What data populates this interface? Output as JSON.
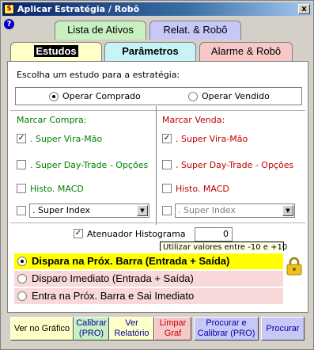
{
  "window": {
    "title": "Aplicar Estratégia / Robô",
    "close_label": "x",
    "help_label": "?"
  },
  "tabs_top": [
    {
      "label": "Lista de Ativos"
    },
    {
      "label": "Relat. & Robô"
    }
  ],
  "tabs_bottom": [
    {
      "label": "Estudos"
    },
    {
      "label": "Parâmetros"
    },
    {
      "label": "Alarme & Robô"
    }
  ],
  "strategy": {
    "prompt": "Escolha um estudo para a estratégia:",
    "options": [
      {
        "label": "Operar Comprado",
        "selected": true
      },
      {
        "label": "Operar Vendido",
        "selected": false
      }
    ]
  },
  "buy": {
    "header": "Marcar Compra:",
    "items": [
      {
        "label": ". Super Vira-Mão",
        "checked": true
      },
      {
        "label": ". Super Day-Trade - Opções",
        "checked": false
      },
      {
        "label": "Histo. MACD",
        "checked": false
      }
    ],
    "combo": {
      "value": ". Super Index",
      "checked": false
    }
  },
  "sell": {
    "header": "Marcar Venda:",
    "items": [
      {
        "label": ". Super Vira-Mão",
        "checked": true
      },
      {
        "label": ". Super Day-Trade - Opções",
        "checked": false
      },
      {
        "label": "Histo. MACD",
        "checked": false
      }
    ],
    "combo": {
      "value": ". Super Index",
      "checked": false
    }
  },
  "attenuator": {
    "label": "Atenuador Histograma",
    "checked": true,
    "value": "0",
    "tooltip": "Utilizar valores entre -10 e +10"
  },
  "entry_modes": [
    {
      "label": "Dispara na Próx. Barra (Entrada + Saída)",
      "selected": true
    },
    {
      "label": "Disparo Imediato (Entrada + Saída)",
      "selected": false
    },
    {
      "label": "Entra na Próx. Barra e Sai Imediato",
      "selected": false
    }
  ],
  "buttons": {
    "ver_grafico": "Ver no Gráfico",
    "calibrar": [
      "Calibrar",
      "(PRO)"
    ],
    "ver_relatorio": [
      "Ver",
      "Relatório"
    ],
    "limpar": [
      "Limpar",
      "Graf"
    ],
    "procurar_calibrar": [
      "Procurar e",
      "Calibrar (PRO)"
    ],
    "procurar": "Procurar"
  },
  "colors": {
    "buy_text": "#008000",
    "sell_text": "#c00000",
    "selected_mode": "#ffff00"
  }
}
